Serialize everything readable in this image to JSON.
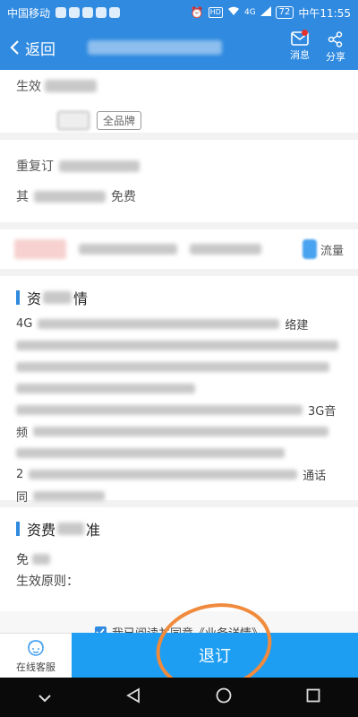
{
  "statusbar": {
    "carrier": "中国移动",
    "battery": "72",
    "time": "中午11:55",
    "hd": "HD",
    "signal": "4G"
  },
  "header": {
    "back_label": "返回",
    "message_label": "消息",
    "share_label": "分享"
  },
  "section1": {
    "label_prefix": "生效",
    "tag_all_brand": "全品牌"
  },
  "section2": {
    "line1_prefix": "重复订",
    "line2_prefix": "其",
    "line2_suffix": "免费"
  },
  "section3": {
    "last_label": "流量"
  },
  "details": {
    "title": "资",
    "title_suffix": "情",
    "lines": [
      {
        "lead": "4G",
        "tail": "络建"
      },
      {
        "lead": "",
        "tail": ""
      },
      {
        "lead": "",
        "tail": ""
      },
      {
        "lead": "",
        "tail": ""
      },
      {
        "lead": "",
        "tail": "3G音"
      },
      {
        "lead": "频",
        "tail": ""
      },
      {
        "lead": "",
        "tail": ""
      },
      {
        "lead": "2",
        "tail": "通话"
      },
      {
        "lead": "同",
        "tail": ""
      }
    ]
  },
  "tariff": {
    "title_lead": "资费",
    "title_tail": "准",
    "line1": "免",
    "line2": "生效原则："
  },
  "agreement": {
    "text": "我已阅读并同意《业务详情》"
  },
  "bottom": {
    "service_label": "在线客服",
    "unsubscribe_label": "退订"
  },
  "colors": {
    "primary": "#2f8ae0",
    "cta": "#1e9ef2",
    "annotation": "#f08a3c",
    "badge": "#e5322d"
  }
}
